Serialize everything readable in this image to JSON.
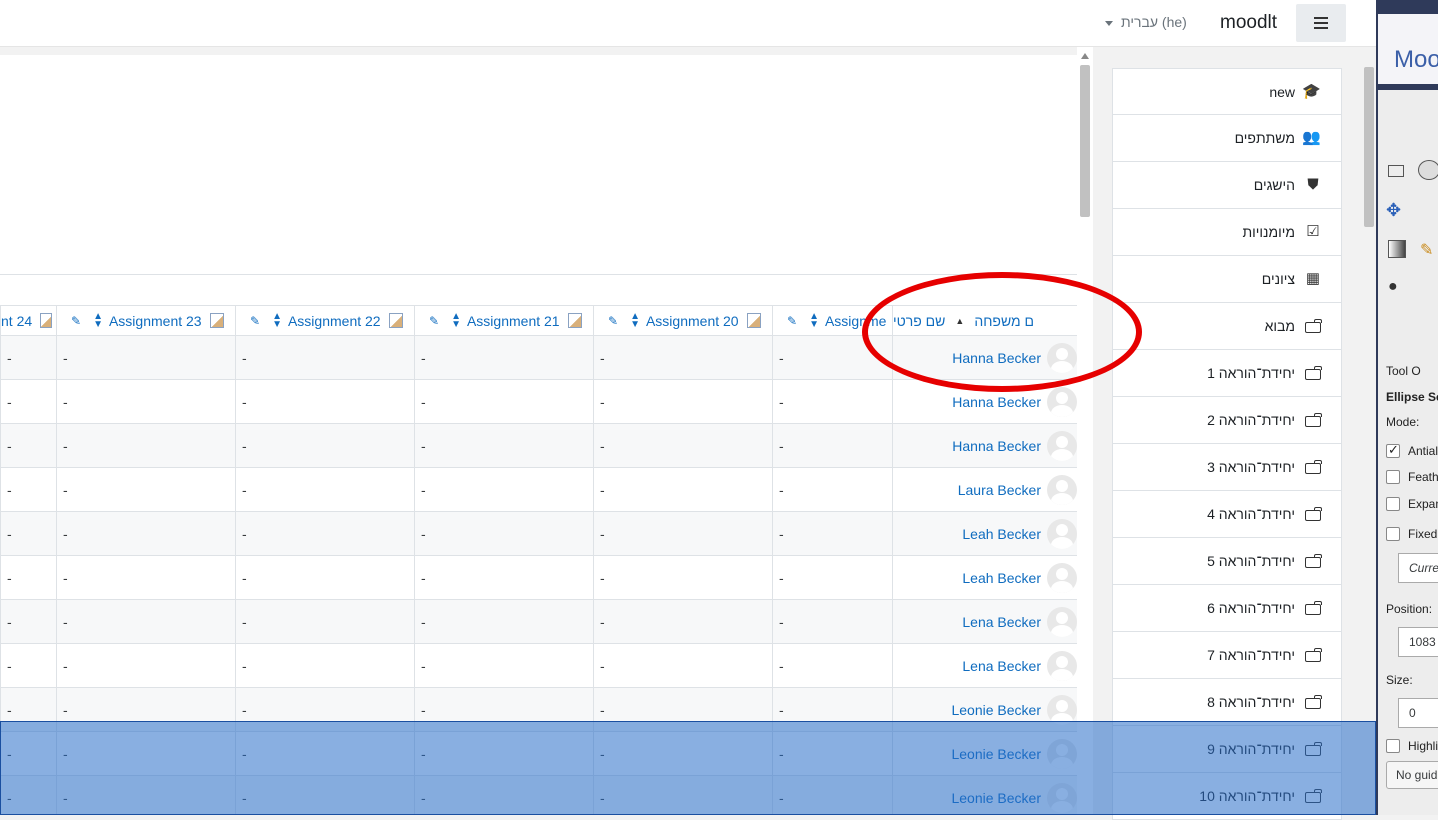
{
  "navbar": {
    "brand": "moodlt",
    "language": "עברית (he)"
  },
  "grader": {
    "columns": [
      {
        "label": "nt 24"
      },
      {
        "label": "Assignment 23"
      },
      {
        "label": "Assignment 22"
      },
      {
        "label": "Assignment 21"
      },
      {
        "label": "Assignment 20"
      },
      {
        "label": "Assignme"
      }
    ],
    "first_name_header": "שם פרטי",
    "last_name_header": "ם משפחה",
    "empty_grade": "-",
    "rows": [
      {
        "name": "Hanna Becker"
      },
      {
        "name": "Hanna Becker"
      },
      {
        "name": "Hanna Becker"
      },
      {
        "name": "Laura Becker"
      },
      {
        "name": "Leah Becker"
      },
      {
        "name": "Leah Becker"
      },
      {
        "name": "Lena Becker"
      },
      {
        "name": "Lena Becker"
      },
      {
        "name": "Leonie Becker"
      },
      {
        "name": "Leonie Becker"
      },
      {
        "name": "Leonie Becker"
      }
    ]
  },
  "drawer": {
    "items": [
      {
        "label": "new",
        "icon": "graduation-cap-icon",
        "glyph": "🎓"
      },
      {
        "label": "משתתפים",
        "icon": "users-icon",
        "glyph": "👥"
      },
      {
        "label": "הישגים",
        "icon": "shield-icon",
        "glyph": "⛊"
      },
      {
        "label": "מיומנויות",
        "icon": "check-square-icon",
        "glyph": "☑"
      },
      {
        "label": "ציונים",
        "icon": "table-icon",
        "glyph": "▦"
      },
      {
        "label": "מבוא",
        "icon": "folder-icon",
        "glyph": ""
      },
      {
        "label": "יחידת־הוראה 1",
        "icon": "folder-icon",
        "glyph": ""
      },
      {
        "label": "יחידת־הוראה 2",
        "icon": "folder-icon",
        "glyph": ""
      },
      {
        "label": "יחידת־הוראה 3",
        "icon": "folder-icon",
        "glyph": ""
      },
      {
        "label": "יחידת־הוראה 4",
        "icon": "folder-icon",
        "glyph": ""
      },
      {
        "label": "יחידת־הוראה 5",
        "icon": "folder-icon",
        "glyph": ""
      },
      {
        "label": "יחידת־הוראה 6",
        "icon": "folder-icon",
        "glyph": ""
      },
      {
        "label": "יחידת־הוראה 7",
        "icon": "folder-icon",
        "glyph": ""
      },
      {
        "label": "יחידת־הוראה 8",
        "icon": "folder-icon",
        "glyph": ""
      },
      {
        "label": "יחידת־הוראה 9",
        "icon": "folder-icon",
        "glyph": ""
      },
      {
        "label": "יחידת־הוראה 10",
        "icon": "folder-icon",
        "glyph": ""
      }
    ]
  },
  "gimp": {
    "title": "Moo",
    "tool_options_label": "Tool O",
    "section": "Ellipse Se",
    "mode_label": "Mode:",
    "antialias": "Antial",
    "feather": "Feathe",
    "expand": "Expan",
    "fixed": "Fixed:",
    "current": "Curre",
    "position_label": "Position:",
    "position_value": "1083",
    "size_label": "Size:",
    "size_value": "0",
    "highlight": "Highli",
    "no_guides": "No guid"
  },
  "colors": {
    "link": "#0f6cbf",
    "selection": "#286ec8",
    "annotation": "#e60000"
  }
}
